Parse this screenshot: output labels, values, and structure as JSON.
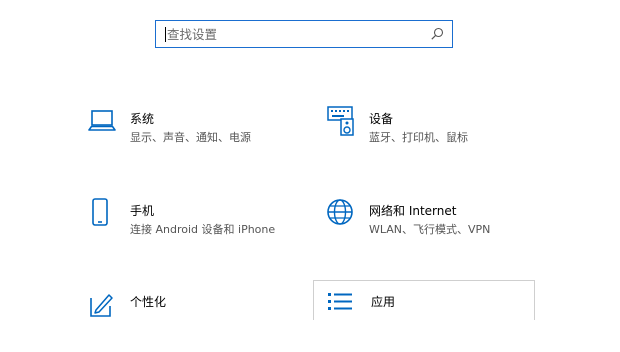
{
  "search": {
    "placeholder": "查找设置",
    "value": ""
  },
  "tiles": [
    {
      "title": "系统",
      "desc": "显示、声音、通知、电源",
      "icon": "laptop-icon"
    },
    {
      "title": "设备",
      "desc": "蓝牙、打印机、鼠标",
      "icon": "keyboard-speaker-icon"
    },
    {
      "title": "手机",
      "desc": "连接 Android 设备和 iPhone",
      "icon": "phone-icon"
    },
    {
      "title": "网络和 Internet",
      "desc": "WLAN、飞行模式、VPN",
      "icon": "globe-icon"
    },
    {
      "title": "个性化",
      "desc": "",
      "icon": "pen-tablet-icon"
    },
    {
      "title": "应用",
      "desc": "",
      "icon": "app-list-icon"
    }
  ],
  "colors": {
    "accent": "#0067c0",
    "focus_border": "#1a6ed0",
    "hover_border": "#cfcfcf"
  }
}
